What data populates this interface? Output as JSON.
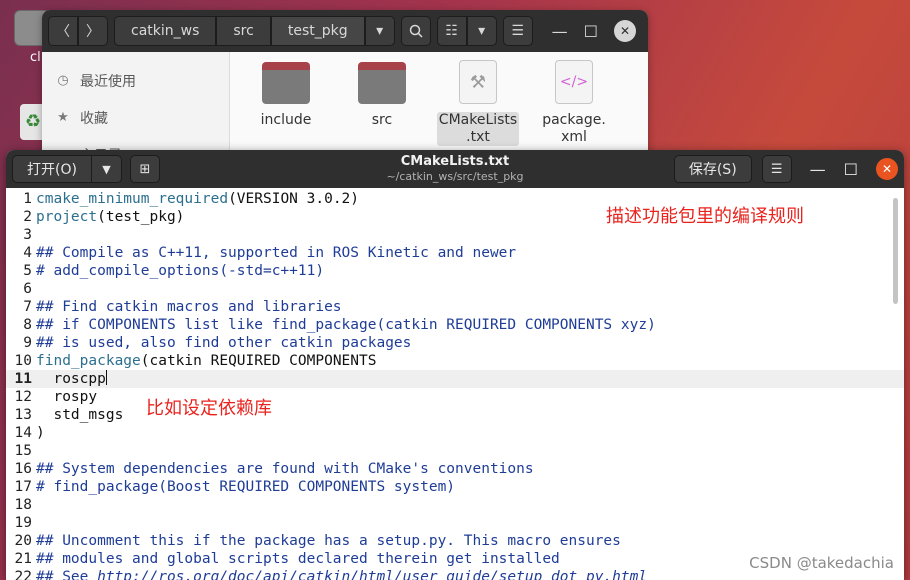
{
  "desktop": {
    "home_label": "cl"
  },
  "file_manager": {
    "breadcrumbs": [
      "catkin_ws",
      "src",
      "test_pkg"
    ],
    "sidebar": [
      {
        "label": "最近使用",
        "icon": "clock-icon"
      },
      {
        "label": "收藏",
        "icon": "star-icon"
      },
      {
        "label": "主目录",
        "icon": "home-icon"
      }
    ],
    "files": [
      {
        "label": "include",
        "type": "folder"
      },
      {
        "label": "src",
        "type": "folder"
      },
      {
        "label": "CMakeLists\n.txt",
        "type": "cmake"
      },
      {
        "label": "package.\nxml",
        "type": "xml"
      }
    ]
  },
  "editor": {
    "open_label": "打开(O)",
    "title": "CMakeLists.txt",
    "subtitle": "~/catkin_ws/src/test_pkg",
    "save_label": "保存(S)",
    "current_line": 11,
    "lines": [
      {
        "n": "1",
        "parts": [
          {
            "c": "fn",
            "t": "cmake_minimum_required"
          },
          {
            "c": "tx",
            "t": "(VERSION 3.0.2)"
          }
        ]
      },
      {
        "n": "2",
        "parts": [
          {
            "c": "fn",
            "t": "project"
          },
          {
            "c": "tx",
            "t": "(test_pkg)"
          }
        ]
      },
      {
        "n": "3",
        "parts": []
      },
      {
        "n": "4",
        "parts": [
          {
            "c": "cmt",
            "t": "## Compile as C++11, supported in ROS Kinetic and newer"
          }
        ]
      },
      {
        "n": "5",
        "parts": [
          {
            "c": "cmt",
            "t": "# add_compile_options(-std=c++11)"
          }
        ]
      },
      {
        "n": "6",
        "parts": []
      },
      {
        "n": "7",
        "parts": [
          {
            "c": "cmt",
            "t": "## Find catkin macros and libraries"
          }
        ]
      },
      {
        "n": "8",
        "parts": [
          {
            "c": "cmt",
            "t": "## if COMPONENTS list like find_package(catkin REQUIRED COMPONENTS xyz)"
          }
        ]
      },
      {
        "n": "9",
        "parts": [
          {
            "c": "cmt",
            "t": "## is used, also find other catkin packages"
          }
        ]
      },
      {
        "n": "10",
        "parts": [
          {
            "c": "fn",
            "t": "find_package"
          },
          {
            "c": "tx",
            "t": "(catkin REQUIRED COMPONENTS"
          }
        ]
      },
      {
        "n": "11",
        "parts": [
          {
            "c": "tx",
            "t": "  roscpp"
          }
        ]
      },
      {
        "n": "12",
        "parts": [
          {
            "c": "tx",
            "t": "  rospy"
          }
        ]
      },
      {
        "n": "13",
        "parts": [
          {
            "c": "tx",
            "t": "  std_msgs"
          }
        ]
      },
      {
        "n": "14",
        "parts": [
          {
            "c": "tx",
            "t": ")"
          }
        ]
      },
      {
        "n": "15",
        "parts": []
      },
      {
        "n": "16",
        "parts": [
          {
            "c": "cmt",
            "t": "## System dependencies are found with CMake's conventions"
          }
        ]
      },
      {
        "n": "17",
        "parts": [
          {
            "c": "cmt",
            "t": "# find_package(Boost REQUIRED COMPONENTS system)"
          }
        ]
      },
      {
        "n": "18",
        "parts": []
      },
      {
        "n": "19",
        "parts": []
      },
      {
        "n": "20",
        "parts": [
          {
            "c": "cmt",
            "t": "## Uncomment this if the package has a setup.py. This macro ensures"
          }
        ]
      },
      {
        "n": "21",
        "parts": [
          {
            "c": "cmt",
            "t": "## modules and global scripts declared therein get installed"
          }
        ]
      },
      {
        "n": "22",
        "parts": [
          {
            "c": "cmt",
            "t": "## See "
          },
          {
            "c": "url",
            "t": "http://ros.org/doc/api/catkin/html/user_guide/setup_dot_py.html"
          }
        ]
      }
    ]
  },
  "annotations": {
    "top": "描述功能包里的编译规则",
    "middle": "比如设定依赖库"
  },
  "watermark": "CSDN @takedachia",
  "colors": {
    "accent_close": "#e95420",
    "annotation": "#e8231d"
  }
}
